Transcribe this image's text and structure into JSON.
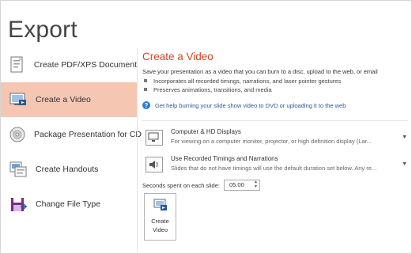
{
  "page": {
    "title": "Export"
  },
  "nav": {
    "items": [
      {
        "id": "pdf",
        "label": "Create PDF/XPS Document",
        "icon": "pdf-document-icon",
        "selected": false
      },
      {
        "id": "video",
        "label": "Create a Video",
        "icon": "video-icon",
        "selected": true
      },
      {
        "id": "package",
        "label": "Package Presentation for CD",
        "icon": "cd-icon",
        "selected": false
      },
      {
        "id": "handouts",
        "label": "Create Handouts",
        "icon": "handouts-icon",
        "selected": false
      },
      {
        "id": "filetype",
        "label": "Change File Type",
        "icon": "change-file-type-icon",
        "selected": false
      }
    ]
  },
  "main": {
    "heading": "Create a Video",
    "description": "Save your presentation as a video that you can burn to a disc, upload to the web, or email",
    "bullets": [
      "Incorporates all recorded timings, narrations, and laser pointer gestures",
      "Preserves animations, transitions, and media"
    ],
    "help_link": "Get help burning your slide show video to DVD or uploading it to the web",
    "quality": {
      "title": "Computer & HD Displays",
      "subtitle": "For viewing on a computer monitor, projector, or high definition display  (Lar..."
    },
    "timings": {
      "title": "Use Recorded Timings and Narrations",
      "subtitle": "Slides that do not have timings will use the default duration set below. Any re..."
    },
    "seconds": {
      "label": "Seconds spent on each slide:",
      "value": "05.00"
    },
    "create_button": {
      "line1": "Create",
      "line2": "Video"
    }
  },
  "colors": {
    "accent": "#d24726",
    "selected_bg": "#f5c7b3",
    "link": "#2b579a"
  }
}
